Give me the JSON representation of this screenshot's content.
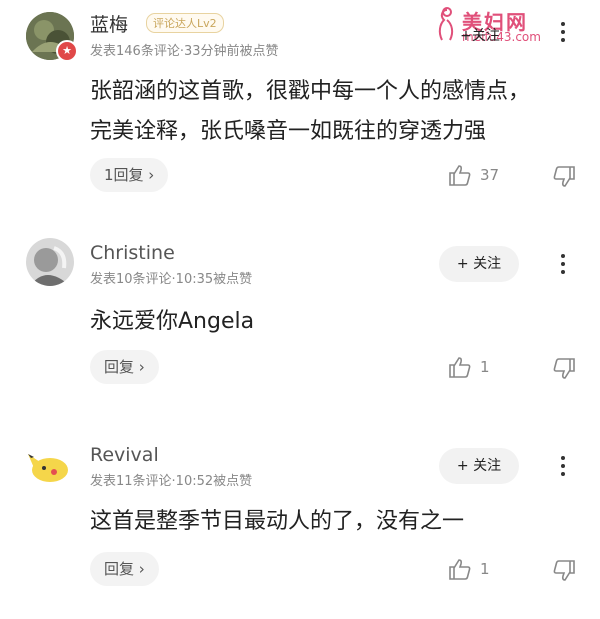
{
  "watermark": {
    "title": "美妇网",
    "url": "meifu43.com"
  },
  "comments": [
    {
      "name": "蓝梅",
      "badge": "评论达人Lv2",
      "meta": "发表146条评论·33分钟前被点赞",
      "follow_label": "+关注",
      "lines": [
        "张韶涵的这首歌，很戳中每一个人的感情点，",
        "完美诠释，张氏嗓音一如既往的穿透力强"
      ],
      "reply_label": "1回复 ›",
      "likes": "37"
    },
    {
      "name": "Christine",
      "meta": "发表10条评论·10:35被点赞",
      "follow_label": "+ 关注",
      "lines": [
        "永远爱你Angela"
      ],
      "reply_label": "回复 ›",
      "likes": "1"
    },
    {
      "name": "Revival",
      "meta": "发表11条评论·10:52被点赞",
      "follow_label": "+ 关注",
      "lines": [
        "这首是整季节目最动人的了，没有之一"
      ],
      "reply_label": "回复 ›",
      "likes": "1"
    }
  ],
  "icons": {
    "like": "thumbs-up-icon",
    "dislike": "thumbs-down-icon",
    "more": "more-vertical-icon"
  }
}
